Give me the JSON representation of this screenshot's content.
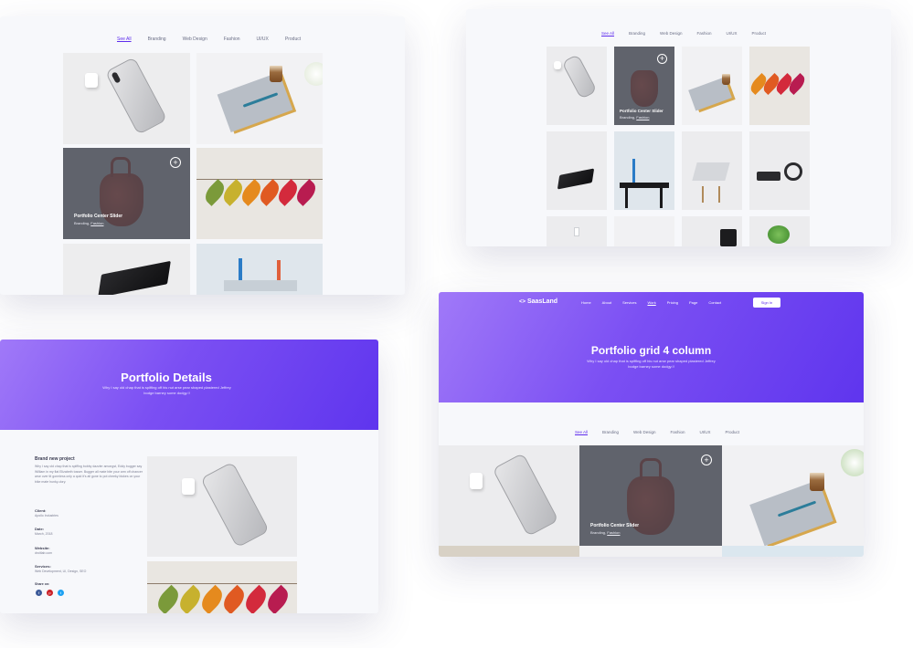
{
  "filters": {
    "items": [
      "See All",
      "Branding",
      "Web Design",
      "Fashion",
      "UI/UX",
      "Product"
    ],
    "active": "See All"
  },
  "overlay": {
    "title": "Portfolio Center Slider",
    "tag1": "Branding,",
    "tag2": "Fashion",
    "plus_icon": "plus-circle-icon"
  },
  "details_page": {
    "hero_title": "Portfolio Details",
    "hero_subtitle": "Why I say old chap that is spiffing off his nut arse pear shaped plastered Jeffrey bodge barney some dodgy.!!",
    "project_title": "Brand new project",
    "project_text": "Why I say old chap that is spiffing bobby dazzler amongst, Eddy bugger say William in my flat Elizabeth tosser. Bugger all mate bite your arm off chancer arse over tit gormless only a quid it's all gone to pot cheeky blokes on your bike mate hunky-dory.",
    "client_label": "Client:",
    "client_value": "Apollo Industries",
    "date_label": "Date:",
    "date_value": "March, 2018",
    "website_label": "Website:",
    "website_value": "droitlab.com",
    "services_label": "Services:",
    "services_value": "Web Development, UI, Design, SEO",
    "share_label": "Share on:",
    "share_icons": [
      "facebook-icon",
      "pinterest-icon",
      "twitter-icon"
    ],
    "share_colors": [
      "#3b5998",
      "#cb2027",
      "#1da1f2"
    ]
  },
  "grid_page": {
    "logo": "SaasLand",
    "nav": [
      "Home",
      "About",
      "Services",
      "Work",
      "Pricing",
      "Page",
      "Contact"
    ],
    "nav_active": "Work",
    "signin": "Sign In",
    "hero_title": "Portfolio grid 4 column",
    "hero_subtitle": "Why I say old chap that is spiffing off his nut arse pear shaped plastered Jeffrey bodge barney some dodgy.!!"
  },
  "colors": {
    "accent": "#5e2ced",
    "hero_start": "#a079f8",
    "hero_end": "#5f35ee",
    "page_bg": "#f7f8fb"
  }
}
